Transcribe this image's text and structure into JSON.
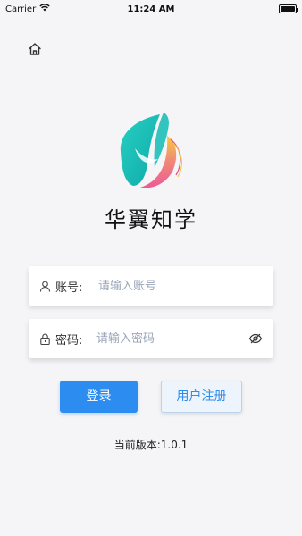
{
  "status_bar": {
    "carrier": "Carrier",
    "time": "11:24 AM",
    "battery_level": 1.0
  },
  "header": {
    "home_icon": "home-icon"
  },
  "app": {
    "title": "华翼知学",
    "logo_icon": "butterfly-wing-logo"
  },
  "form": {
    "account": {
      "icon": "user-icon",
      "label": "账号:",
      "placeholder": "请输入账号",
      "value": ""
    },
    "password": {
      "icon": "lock-icon",
      "label": "密码:",
      "placeholder": "请输入密码",
      "value": "",
      "toggle_icon": "eye-off-icon"
    }
  },
  "actions": {
    "login_label": "登录",
    "register_label": "用户注册"
  },
  "footer": {
    "version_text": "当前版本:1.0.1"
  },
  "colors": {
    "primary": "#2d8cf0",
    "background": "#f5f5f7",
    "logo_teal": "#1fbfb8",
    "logo_pink": "#e94a8a",
    "logo_yellow": "#f5c531"
  }
}
